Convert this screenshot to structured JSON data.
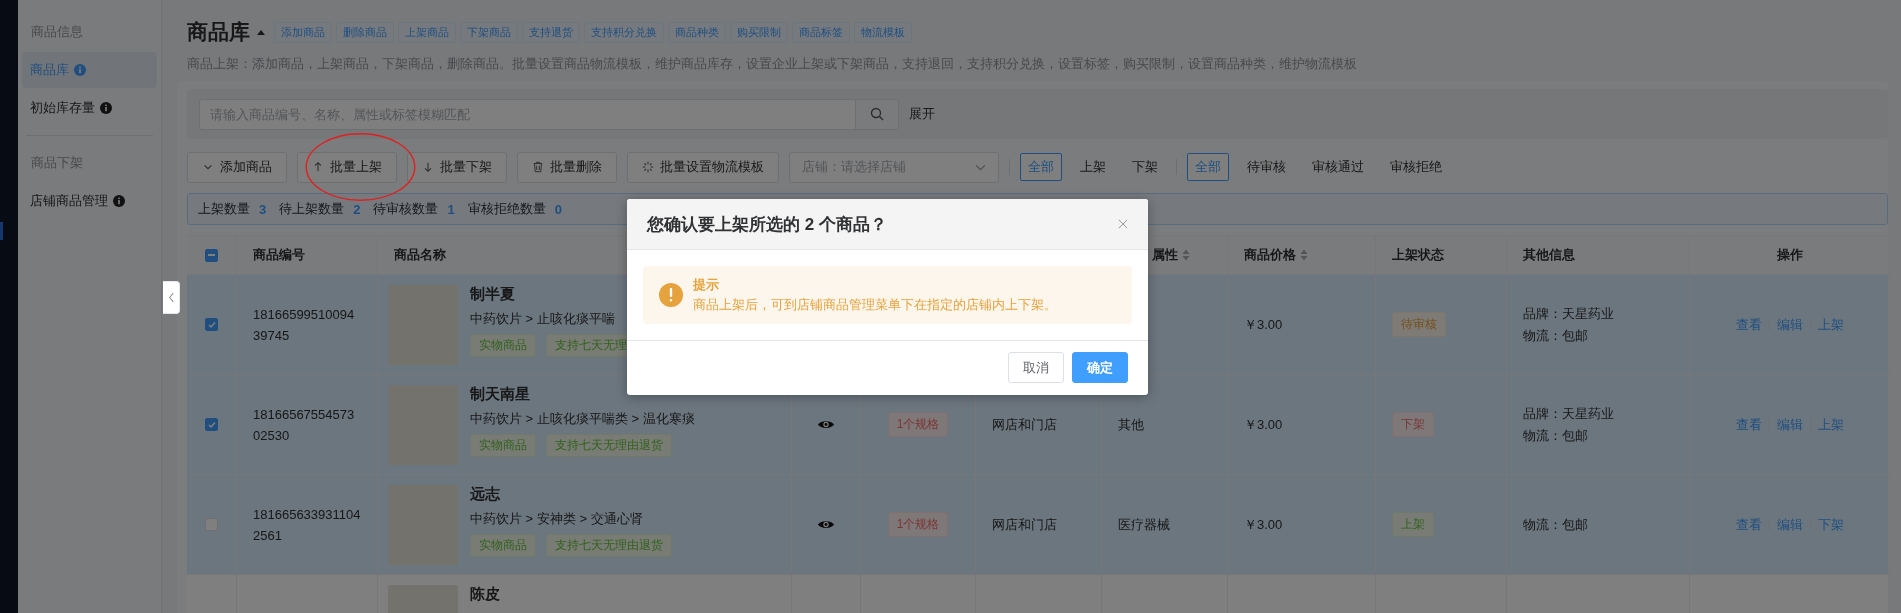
{
  "sidebar": {
    "groups": [
      {
        "title": "商品信息",
        "items": [
          {
            "label": "商品库",
            "info": true,
            "selected": true
          },
          {
            "label": "初始库存量",
            "info": true,
            "selected": false
          }
        ]
      },
      {
        "title": "商品下架",
        "items": [
          {
            "label": "店铺商品管理",
            "info": true,
            "selected": false
          }
        ]
      }
    ]
  },
  "page": {
    "title": "商品库",
    "quick_links": [
      "添加商品",
      "删除商品",
      "上架商品",
      "下架商品",
      "支持退货",
      "支持积分兑换",
      "商品种类",
      "购买限制",
      "商品标签",
      "物流模板"
    ],
    "description": "商品上架：添加商品，上架商品，下架商品，删除商品。批量设置商品物流模板，维护商品库存，设置企业上架或下架商品，支持退回，支持积分兑换，设置标签，购买限制，设置商品种类，维护物流模板"
  },
  "search": {
    "placeholder": "请输入商品编号、名称、属性或标签模糊匹配",
    "expand_link": "展开"
  },
  "toolbar": {
    "buttons": [
      "添加商品",
      "批量上架",
      "批量下架",
      "批量删除",
      "批量设置物流模板"
    ],
    "store_select": {
      "placeholder": "店铺：请选择店铺"
    },
    "shelf_filter": [
      {
        "label": "全部",
        "selected": true
      },
      {
        "label": "上架",
        "selected": false
      },
      {
        "label": "下架",
        "selected": false
      }
    ],
    "review_filter": [
      {
        "label": "全部",
        "selected": true
      },
      {
        "label": "待审核",
        "selected": false
      },
      {
        "label": "审核通过",
        "selected": false
      },
      {
        "label": "审核拒绝",
        "selected": false
      }
    ]
  },
  "summary": [
    {
      "label": "上架数量",
      "count": "3"
    },
    {
      "label": "待上架数量",
      "count": "2"
    },
    {
      "label": "待审核数量",
      "count": "1"
    },
    {
      "label": "审核拒绝数量",
      "count": "0"
    }
  ],
  "table": {
    "header_indeterminate": true,
    "columns": [
      {
        "label": "商品编号"
      },
      {
        "label": "商品名称"
      },
      null,
      null,
      null,
      {
        "label": "属性",
        "sortable": true
      },
      {
        "label": "商品价格",
        "sortable": true
      },
      {
        "label": "上架状态"
      },
      {
        "label": "其他信息"
      },
      {
        "label": "操作"
      }
    ],
    "rows": [
      {
        "selected": true,
        "highlighted": true,
        "code": "1816659951009439745",
        "name": "制半夏",
        "category": "中药饮片 > 止咳化痰平喘",
        "tags": [
          "实物商品",
          "支持七天无理"
        ],
        "price": "￥3.00",
        "status": {
          "label": "待审核",
          "kind": "pending"
        },
        "info": [
          "品牌：天星药业",
          "物流：包邮"
        ],
        "actions": [
          "查看",
          "编辑",
          "上架"
        ]
      },
      {
        "selected": true,
        "highlighted": true,
        "code": "1816656755457302530",
        "name": "制天南星",
        "category": "中药饮片 > 止咳化痰平喘类 > 温化寒痰",
        "tags": [
          "实物商品",
          "支持七天无理由退货"
        ],
        "preview": true,
        "spec": "1个规格",
        "channel": "网店和门店",
        "attribute": "其他",
        "price": "￥3.00",
        "status": {
          "label": "下架",
          "kind": "off"
        },
        "info": [
          "品牌：天星药业",
          "物流：包邮"
        ],
        "actions": [
          "查看",
          "编辑",
          "上架"
        ]
      },
      {
        "selected": false,
        "highlighted": true,
        "code": "1816656339311042561",
        "name": "远志",
        "category": "中药饮片 > 安神类 > 交通心肾",
        "tags": [
          "实物商品",
          "支持七天无理由退货"
        ],
        "preview": true,
        "spec": "1个规格",
        "channel": "网店和门店",
        "attribute": "医疗器械",
        "price": "￥3.00",
        "status": {
          "label": "上架",
          "kind": "on"
        },
        "info": [
          "物流：包邮"
        ],
        "actions": [
          "查看",
          "编辑",
          "下架"
        ]
      },
      {
        "highlighted": false,
        "name": "陈皮"
      }
    ]
  },
  "dialog": {
    "title": "您确认要上架所选的 2 个商品？",
    "alert_title": "提示",
    "alert_text": "商品上架后，可到店铺商品管理菜单下在指定的店铺内上下架。",
    "buttons": [
      {
        "label": "取消",
        "kind": "default"
      },
      {
        "label": "确定",
        "kind": "primary"
      }
    ]
  }
}
